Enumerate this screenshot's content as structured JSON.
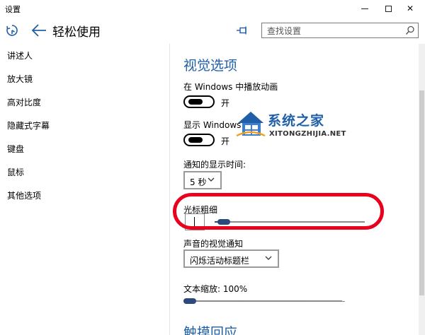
{
  "window": {
    "title": "设置",
    "controls": {
      "minimize": "min",
      "maximize": "max",
      "close": "✕"
    }
  },
  "header": {
    "title": "轻松使用",
    "search_placeholder": "查找设置"
  },
  "sidebar": {
    "items": [
      {
        "label": "讲述人"
      },
      {
        "label": "放大镜"
      },
      {
        "label": "高对比度"
      },
      {
        "label": "隐藏式字幕"
      },
      {
        "label": "键盘"
      },
      {
        "label": "鼠标"
      },
      {
        "label": "其他选项"
      }
    ]
  },
  "main": {
    "section_title": "视觉选项",
    "animations": {
      "label": "在 Windows 中播放动画",
      "state": "开",
      "on": true
    },
    "background": {
      "label": "显示 Windows 背景",
      "state": "开",
      "on": true
    },
    "notification_time": {
      "label": "通知的显示时间:",
      "value": "5 秒"
    },
    "cursor_thickness": {
      "label": "光标粗细",
      "value_fraction": 0.02
    },
    "visual_notification": {
      "label": "声音的视觉通知",
      "value": "闪烁活动标题栏"
    },
    "text_scaling": {
      "label": "文本缩放: 100%",
      "value_fraction": 0.0
    },
    "next_section_title": "触摸回应"
  },
  "watermark": {
    "cn": "系统之家",
    "en": "XITONGZHIJIA.NET"
  },
  "colors": {
    "accent": "#1f5fa8",
    "slider": "#2b4a7a",
    "highlight": "#e8001c"
  }
}
